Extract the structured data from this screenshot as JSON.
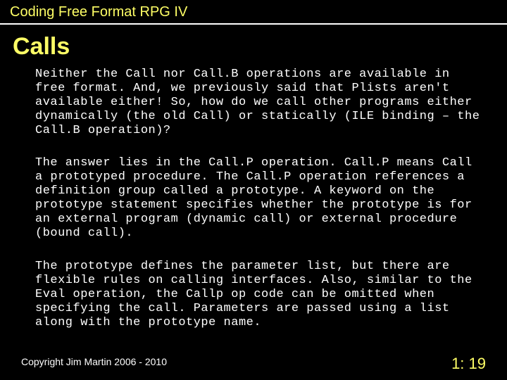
{
  "header": "Coding Free Format RPG IV",
  "title": "Calls",
  "paragraphs": [
    "Neither the Call nor Call.B operations are available in free format. And, we previously said that Plists aren't available either! So, how do we call other programs either dynamically (the old Call) or statically (ILE binding – the Call.B operation)?",
    "The answer lies in the Call.P operation. Call.P means Call a prototyped procedure. The Call.P operation references a definition group called a prototype. A keyword on the prototype statement specifies whether the prototype is for an external program (dynamic call) or external procedure (bound call).",
    "The prototype defines the parameter list, but there are flexible rules on calling interfaces. Also, similar to the Eval operation, the Callp op code can be omitted when specifying the call. Parameters are passed using a list along with the prototype name."
  ],
  "copyright": "Copyright Jim Martin 2006 - 2010",
  "slide_number": "1: 19"
}
